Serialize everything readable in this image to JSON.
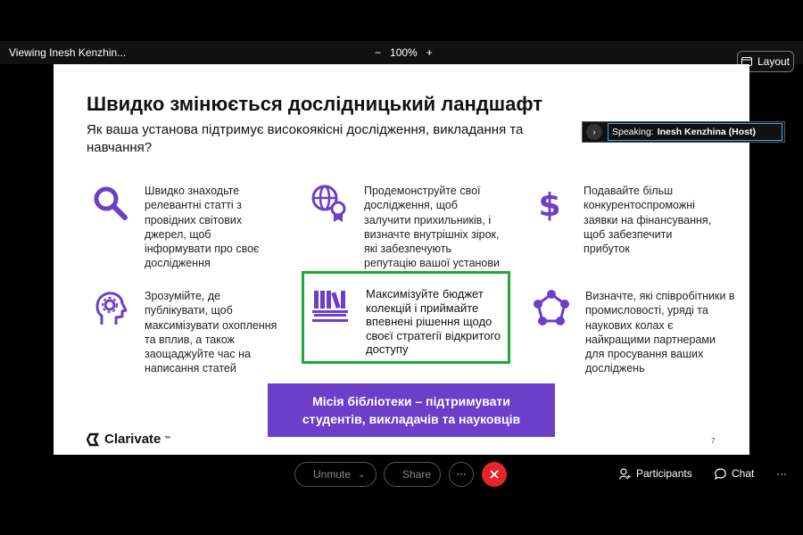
{
  "window": {
    "viewing_label": "Viewing Inesh Kenzhin..."
  },
  "zoom": {
    "minus": "−",
    "level": "100%",
    "plus": "+"
  },
  "layout_button": {
    "label": "Layout"
  },
  "speaking": {
    "prefix": "Speaking:",
    "name": "Inesh Kenzhina (Host)"
  },
  "slide": {
    "title": "Швидко змінюється дослідницький ландшафт",
    "subtitle": "Як ваша установа підтримує високоякісні дослідження, викладання та навчання?",
    "features": [
      {
        "icon": "magnifier-icon",
        "text": "Швидко знаходьте релевантні статті з провідних світових джерел, щоб інформувати про своє дослідження"
      },
      {
        "icon": "globe-award-icon",
        "text": "Продемонструйте свої дослідження, щоб залучити прихильників, і визначте внутрішніх зірок, які забезпечують репутацію вашої установи"
      },
      {
        "icon": "dollar-icon",
        "text": "Подавайте більш конкурентоспроможні заявки на фінансування, щоб забезпечити прибуток"
      },
      {
        "icon": "head-gear-icon",
        "text": "Зрозумійте, де публікувати, щоб максимізувати охоплення та вплив, а також заощаджуйте час на написання статей"
      },
      {
        "icon": "bookshelf-icon",
        "text": "Максимізуйте бюджет колекцій і приймайте впевнені рішення щодо своєї стратегії відкритого доступу"
      },
      {
        "icon": "network-icon",
        "text": "Визначте, які співробітники в промисловості, уряді та наукових колах є найкращими партнерами для просування ваших досліджень"
      }
    ],
    "mission": "Місія бібліотеки – підтримувати студентів, викладачів та науковців",
    "brand": "Clarivate",
    "brand_tm": "™",
    "page_number": "7",
    "accent_color": "#6c3ec9",
    "highlight_color": "#1fa832"
  },
  "controls": {
    "unmute_label": "Unmute",
    "share_label": "Share",
    "more": "···",
    "participants_label": "Participants",
    "chat_label": "Chat",
    "overflow": "···"
  }
}
